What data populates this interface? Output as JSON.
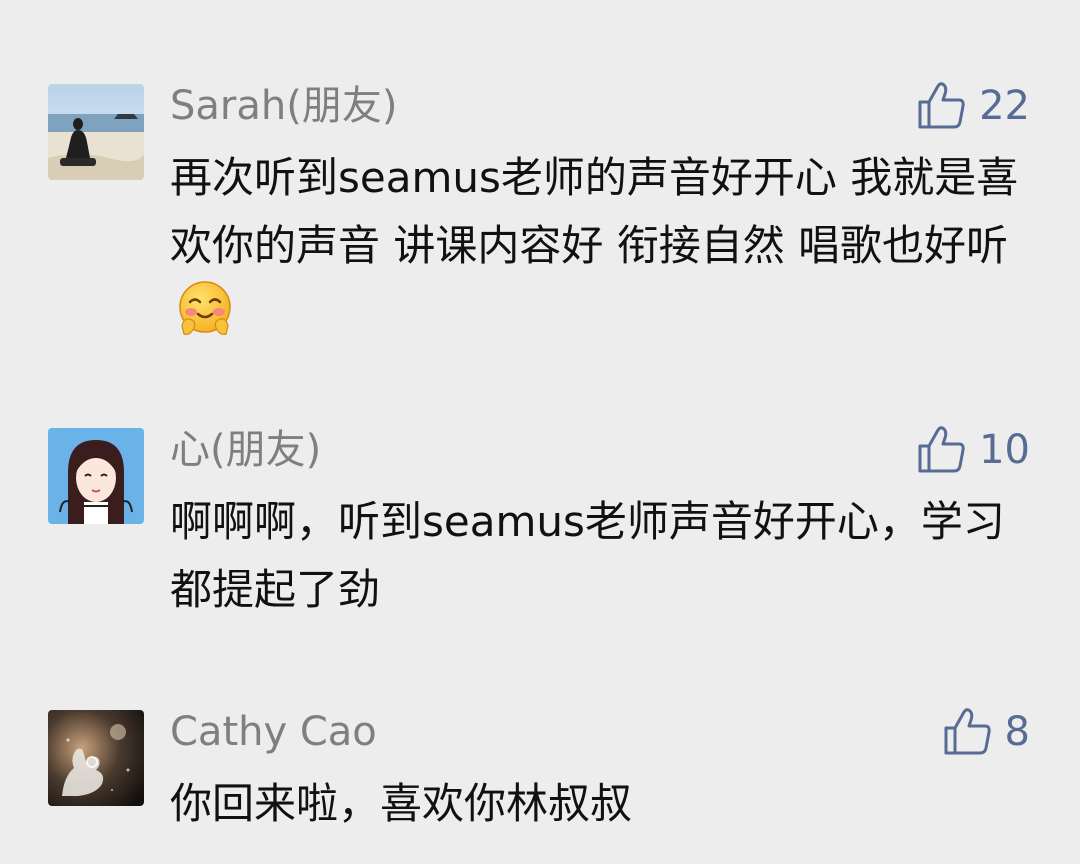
{
  "comments": [
    {
      "author": "Sarah(朋友)",
      "likes": "22",
      "text": "再次听到seamus老师的声音好开心  我就是喜欢你的声音 讲课内容好 衔接自然 唱歌也好听",
      "emoji": "blushing-face-emoji",
      "avatar": "beach-silhouette-avatar"
    },
    {
      "author": "心(朋友)",
      "likes": "10",
      "text": "啊啊啊，听到seamus老师声音好开心，学习都提起了劲",
      "avatar": "cartoon-girl-avatar"
    },
    {
      "author": "Cathy Cao",
      "likes": "8",
      "text": "你回来啦，喜欢你林叔叔",
      "avatar": "hand-gesture-avatar"
    }
  ],
  "icons": {
    "like": "thumbs-up-icon"
  },
  "colors": {
    "background": "#ededed",
    "author": "#7f7f7f",
    "like": "#576b95",
    "text": "#111111"
  }
}
